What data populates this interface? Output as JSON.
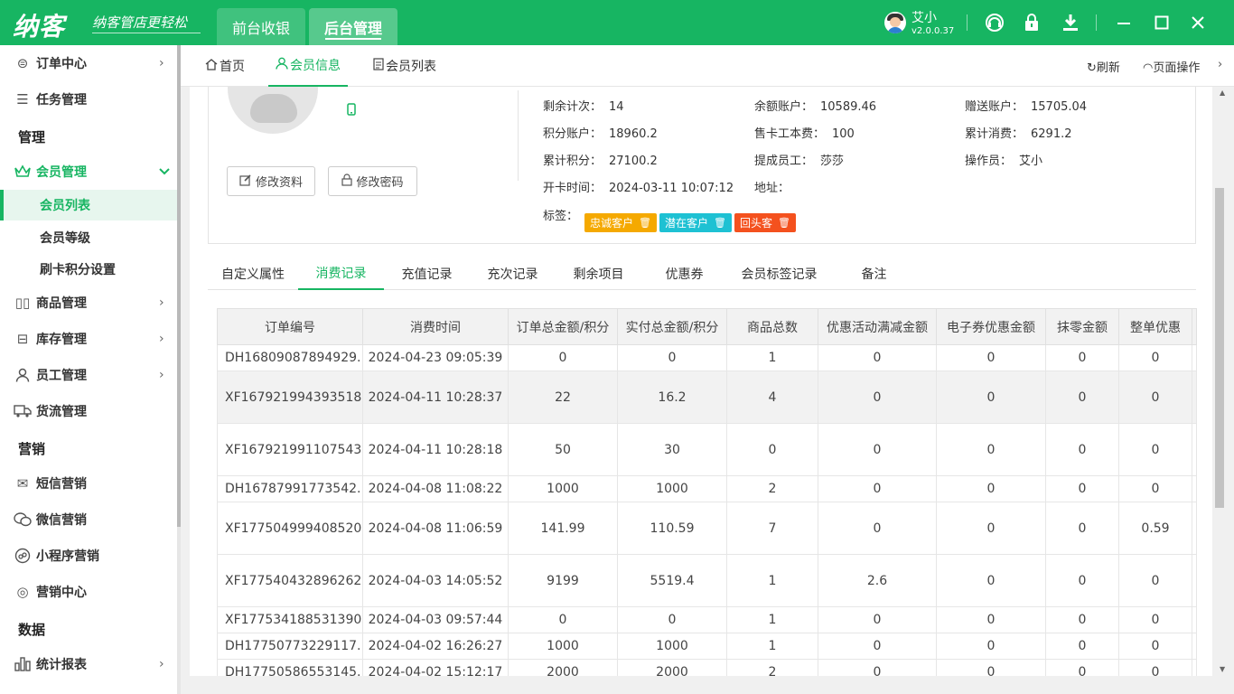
{
  "app": {
    "logo": "纳客",
    "slogan": "纳客管店更轻松",
    "tabs": [
      "前台收银",
      "后台管理"
    ],
    "user": {
      "name": "艾小",
      "version": "v2.0.0.37"
    }
  },
  "sidebar": {
    "items": [
      {
        "label": "订单中心",
        "icon": "order-icon",
        "arrow": "›"
      },
      {
        "label": "任务管理",
        "icon": "task-icon"
      },
      {
        "head": "管理"
      },
      {
        "label": "会员管理",
        "icon": "crown-icon",
        "arrow": "⌄"
      },
      {
        "sub": "会员列表"
      },
      {
        "sub": "会员等级"
      },
      {
        "sub": "刷卡积分设置"
      },
      {
        "label": "商品管理",
        "icon": "goods-icon",
        "arrow": "›"
      },
      {
        "label": "库存管理",
        "icon": "inventory-icon",
        "arrow": "›"
      },
      {
        "label": "员工管理",
        "icon": "staff-icon",
        "arrow": "›"
      },
      {
        "label": "货流管理",
        "icon": "truck-icon"
      },
      {
        "head": "营销"
      },
      {
        "label": "短信营销",
        "icon": "mail-icon"
      },
      {
        "label": "微信营销",
        "icon": "wechat-icon"
      },
      {
        "label": "小程序营销",
        "icon": "miniprogram-icon"
      },
      {
        "label": "营销中心",
        "icon": "target-icon"
      },
      {
        "head": "数据"
      },
      {
        "label": "统计报表",
        "icon": "chart-icon",
        "arrow": "›"
      }
    ]
  },
  "nav": {
    "tabs": [
      "首页",
      "会员信息",
      "会员列表"
    ],
    "refresh": "刷新",
    "page_ops": "页面操作"
  },
  "member": {
    "edit_profile": "修改资料",
    "change_password": "修改密码",
    "fields": [
      {
        "k": "剩余计次：",
        "v": "14"
      },
      {
        "k": "余额账户：",
        "v": "10589.46"
      },
      {
        "k": "赠送账户：",
        "v": "15705.04"
      },
      {
        "k": "积分账户：",
        "v": "18960.2"
      },
      {
        "k": "售卡工本费：",
        "v": "100"
      },
      {
        "k": "累计消费：",
        "v": "6291.2"
      },
      {
        "k": "累计积分：",
        "v": "27100.2"
      },
      {
        "k": "提成员工：",
        "v": "莎莎"
      },
      {
        "k": "操作员：",
        "v": "艾小"
      },
      {
        "k": "开卡时间：",
        "v": "2024-03-11 10:07:12"
      },
      {
        "k": "地址：",
        "v": ""
      }
    ],
    "tags_label": "标签：",
    "tags": [
      {
        "text": "忠诚客户",
        "color": "#f5a900"
      },
      {
        "text": "潜在客户",
        "color": "#1ec1d3"
      },
      {
        "text": "回头客",
        "color": "#f4511e"
      }
    ]
  },
  "subtabs": [
    "自定义属性",
    "消费记录",
    "充值记录",
    "充次记录",
    "剩余项目",
    "优惠券",
    "会员标签记录",
    "备注"
  ],
  "table": {
    "columns": [
      "订单编号",
      "消费时间",
      "订单总金额/积分",
      "实付总金额/积分",
      "商品总数",
      "优惠活动满减金额",
      "电子券优惠金额",
      "抹零金额",
      "整单优惠"
    ],
    "rows": [
      [
        "DH16809087894929...",
        "2024-04-23 09:05:39",
        "0",
        "0",
        "1",
        "0",
        "0",
        "0",
        "0"
      ],
      [
        "XF167921994393518...",
        "2024-04-11 10:28:37",
        "22",
        "16.2",
        "4",
        "0",
        "0",
        "0",
        "0"
      ],
      [
        "XF167921991107543...",
        "2024-04-11 10:28:18",
        "50",
        "30",
        "0",
        "0",
        "0",
        "0",
        "0"
      ],
      [
        "DH16787991773542...",
        "2024-04-08 11:08:22",
        "1000",
        "1000",
        "2",
        "0",
        "0",
        "0",
        "0"
      ],
      [
        "XF177504999408520...",
        "2024-04-08 11:06:59",
        "141.99",
        "110.59",
        "7",
        "0",
        "0",
        "0",
        "0.59"
      ],
      [
        "XF177540432896262...",
        "2024-04-03 14:05:52",
        "9199",
        "5519.4",
        "1",
        "2.6",
        "0",
        "0",
        "0"
      ],
      [
        "XF177534188531390...",
        "2024-04-03 09:57:44",
        "0",
        "0",
        "1",
        "0",
        "0",
        "0",
        "0"
      ],
      [
        "DH17750773229117...",
        "2024-04-02 16:26:27",
        "1000",
        "1000",
        "1",
        "0",
        "0",
        "0",
        "0"
      ],
      [
        "DH17750586553145...",
        "2024-04-02 15:12:17",
        "2000",
        "2000",
        "2",
        "0",
        "0",
        "0",
        "0"
      ]
    ]
  },
  "colors": {
    "brand": "#17b562"
  }
}
